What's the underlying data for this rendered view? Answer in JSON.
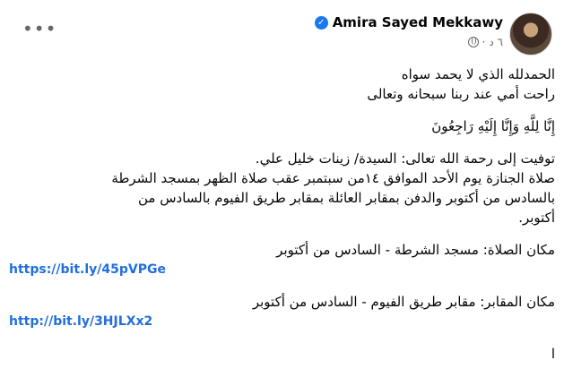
{
  "header": {
    "author": "Amira Sayed Mekkawy",
    "time": "٦ د",
    "more_icon": "more-horizontal-icon"
  },
  "post": {
    "para1": [
      "الحمدلله الذي لا يحمد سواه",
      "راحت أمي عند ربنا سبحانه وتعالى"
    ],
    "verse": "إِنَّا لِلَّهِ وَإِنَّا إِلَيْهِ رَاجِعُونَ",
    "para2": [
      "توفيت إلى رحمة الله تعالى: السيدة/ زينات خليل علي.",
      "صلاة الجنازة يوم الأحد الموافق ١٤من سبتمبر عقب صلاة الظهر بمسجد الشرطة",
      "بالسادس من أكتوبر والدفن بمقابر العائلة بمقابر طريق الفيوم بالسادس من",
      "أكتوبر."
    ],
    "prayer_place": "مكان الصلاة: مسجد الشرطة - السادس من أكتوبر",
    "prayer_link": "https://bit.ly/45pVPGe",
    "cemetery_place": "مكان المقابر: مقابر طريق الفيوم - السادس من أكتوبر",
    "cemetery_link": "http://bit.ly/3HJLXx2",
    "trailing": "ا"
  }
}
